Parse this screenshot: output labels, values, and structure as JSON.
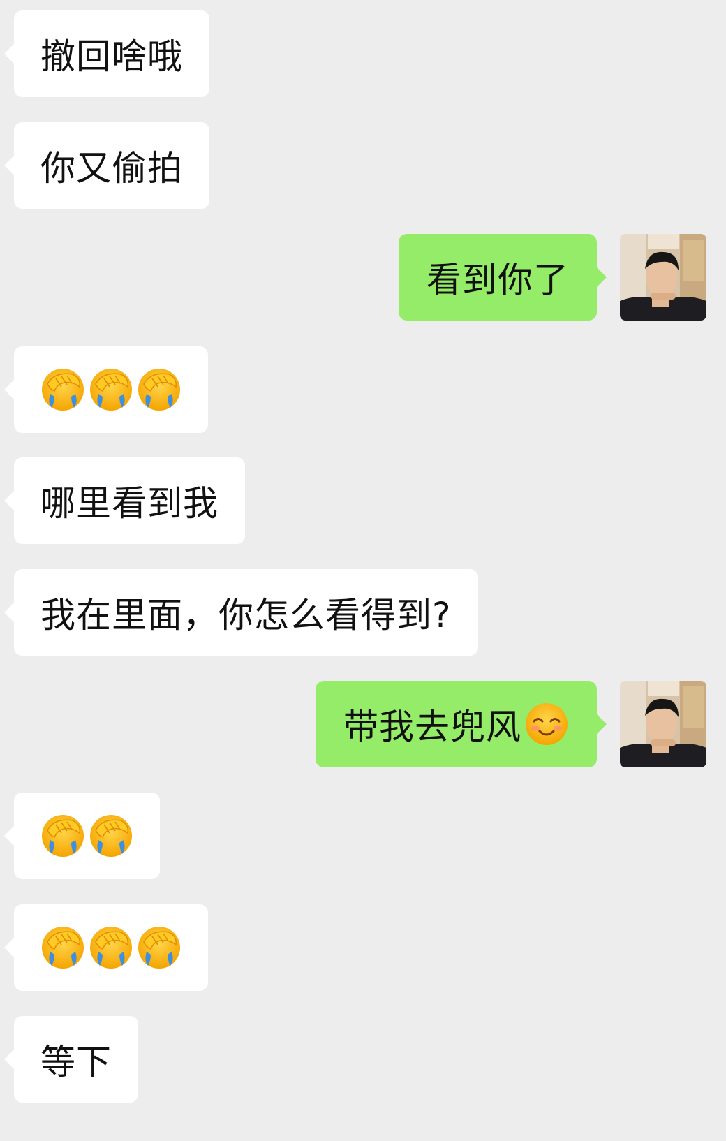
{
  "chat": {
    "messages": [
      {
        "side": "in",
        "text": "撤回啥哦"
      },
      {
        "side": "in",
        "text": "你又偷拍"
      },
      {
        "side": "out",
        "text": "看到你了"
      },
      {
        "side": "in",
        "emoji": "face-palm-crying-emoji",
        "count": 3
      },
      {
        "side": "in",
        "text": "哪里看到我"
      },
      {
        "side": "in",
        "text": "我在里面，你怎么看得到?"
      },
      {
        "side": "out",
        "text": "带我去兜风",
        "trailing_emoji": "blush-smile-emoji"
      },
      {
        "side": "in",
        "emoji": "face-palm-crying-emoji",
        "count": 2
      },
      {
        "side": "in",
        "emoji": "face-palm-crying-emoji",
        "count": 3
      },
      {
        "side": "in",
        "text": "等下"
      }
    ]
  },
  "colors": {
    "background": "#ededed",
    "incoming_bubble": "#ffffff",
    "outgoing_bubble": "#95ec69",
    "text": "#111111"
  },
  "icons": {
    "avatar": "user-avatar-photo",
    "reaction": "face-palm-crying-emoji",
    "smile": "blush-smile-emoji"
  }
}
